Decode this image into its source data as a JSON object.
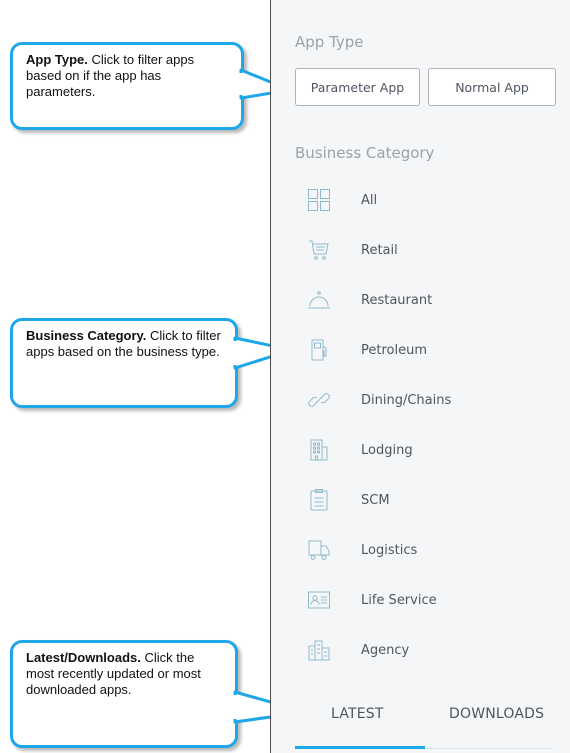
{
  "callouts": {
    "app_type": {
      "title": "App Type.",
      "text": " Click to filter apps based on if the app has parameters."
    },
    "business_category": {
      "title": "Business Category.",
      "text": " Click to filter apps based on the business type."
    },
    "latest_downloads": {
      "title": "Latest/Downloads.",
      "text": " Click the most recently updated or most downloaded apps."
    }
  },
  "panel": {
    "app_type_title": "App Type",
    "app_type_buttons": {
      "parameter": "Parameter App",
      "normal": "Normal App"
    },
    "business_category_title": "Business Category",
    "categories": [
      {
        "label": "All",
        "icon": "grid-icon"
      },
      {
        "label": "Retail",
        "icon": "shopping-cart-icon"
      },
      {
        "label": "Restaurant",
        "icon": "cloche-icon"
      },
      {
        "label": "Petroleum",
        "icon": "fuel-pump-icon"
      },
      {
        "label": "Dining/Chains",
        "icon": "chain-link-icon"
      },
      {
        "label": "Lodging",
        "icon": "hotel-building-icon"
      },
      {
        "label": "SCM",
        "icon": "clipboard-icon"
      },
      {
        "label": "Logistics",
        "icon": "delivery-truck-icon"
      },
      {
        "label": "Life Service",
        "icon": "id-card-icon"
      },
      {
        "label": "Agency",
        "icon": "city-buildings-icon"
      }
    ],
    "tabs": {
      "latest": "LATEST",
      "downloads": "DOWNLOADS"
    }
  },
  "colors": {
    "accent": "#1ea7e8",
    "icon_stroke": "#8fb9cc",
    "panel_bg": "#f5f6f8",
    "muted_text": "#9aa1aa",
    "body_text": "#4f5560"
  }
}
